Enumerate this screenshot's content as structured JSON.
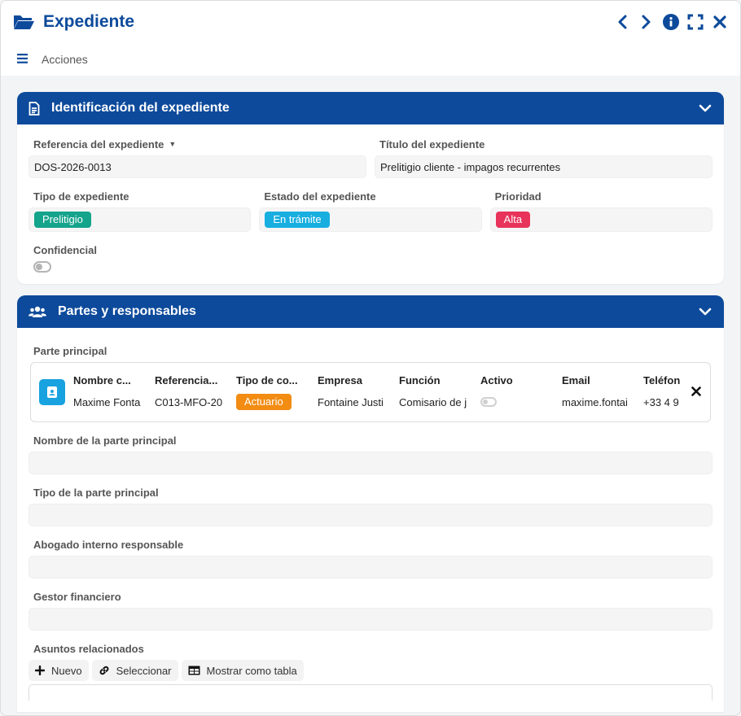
{
  "window": {
    "title": "Expediente",
    "actions_label": "Acciones"
  },
  "colors": {
    "brand": "#0d4a9b",
    "chip_type": "#14a38b",
    "chip_state": "#18aee0",
    "chip_priority": "#e8335a",
    "chip_contact_type": "#f28c12",
    "avatar": "#18a2e0"
  },
  "identification": {
    "title": "Identificación del expediente",
    "reference": {
      "label": "Referencia del expediente",
      "value": "DOS-2026-0013"
    },
    "file_title": {
      "label": "Título del expediente",
      "value": "Prelitigio cliente - impagos recurrentes"
    },
    "type": {
      "label": "Tipo de expediente",
      "value": "Prelitigio"
    },
    "state": {
      "label": "Estado del expediente",
      "value": "En trámite"
    },
    "priority": {
      "label": "Prioridad",
      "value": "Alta"
    },
    "confidential": {
      "label": "Confidencial",
      "checked": false
    }
  },
  "parties": {
    "title": "Partes y responsables",
    "main_party": {
      "label": "Parte principal",
      "columns": [
        {
          "header": "Nombre c...",
          "value": "Maxime Fonta"
        },
        {
          "header": "Referencia...",
          "value": "C013-MFO-20"
        },
        {
          "header": "Tipo de co...",
          "value": "Actuario"
        },
        {
          "header": "Empresa",
          "value": "Fontaine Justi"
        },
        {
          "header": "Función",
          "value": "Comisario de j"
        },
        {
          "header": "Activo",
          "value": ""
        },
        {
          "header": "Email",
          "value": "maxime.fontai"
        },
        {
          "header": "Teléfon",
          "value": "+33 4 9"
        }
      ]
    },
    "main_party_name": {
      "label": "Nombre de la parte principal",
      "value": ""
    },
    "main_party_type": {
      "label": "Tipo de la parte principal",
      "value": ""
    },
    "lawyer": {
      "label": "Abogado interno responsable",
      "value": ""
    },
    "financial_manager": {
      "label": "Gestor financiero",
      "value": ""
    },
    "related": {
      "label": "Asuntos relacionados",
      "new_label": "Nuevo",
      "select_label": "Seleccionar",
      "table_label": "Mostrar como tabla"
    }
  }
}
